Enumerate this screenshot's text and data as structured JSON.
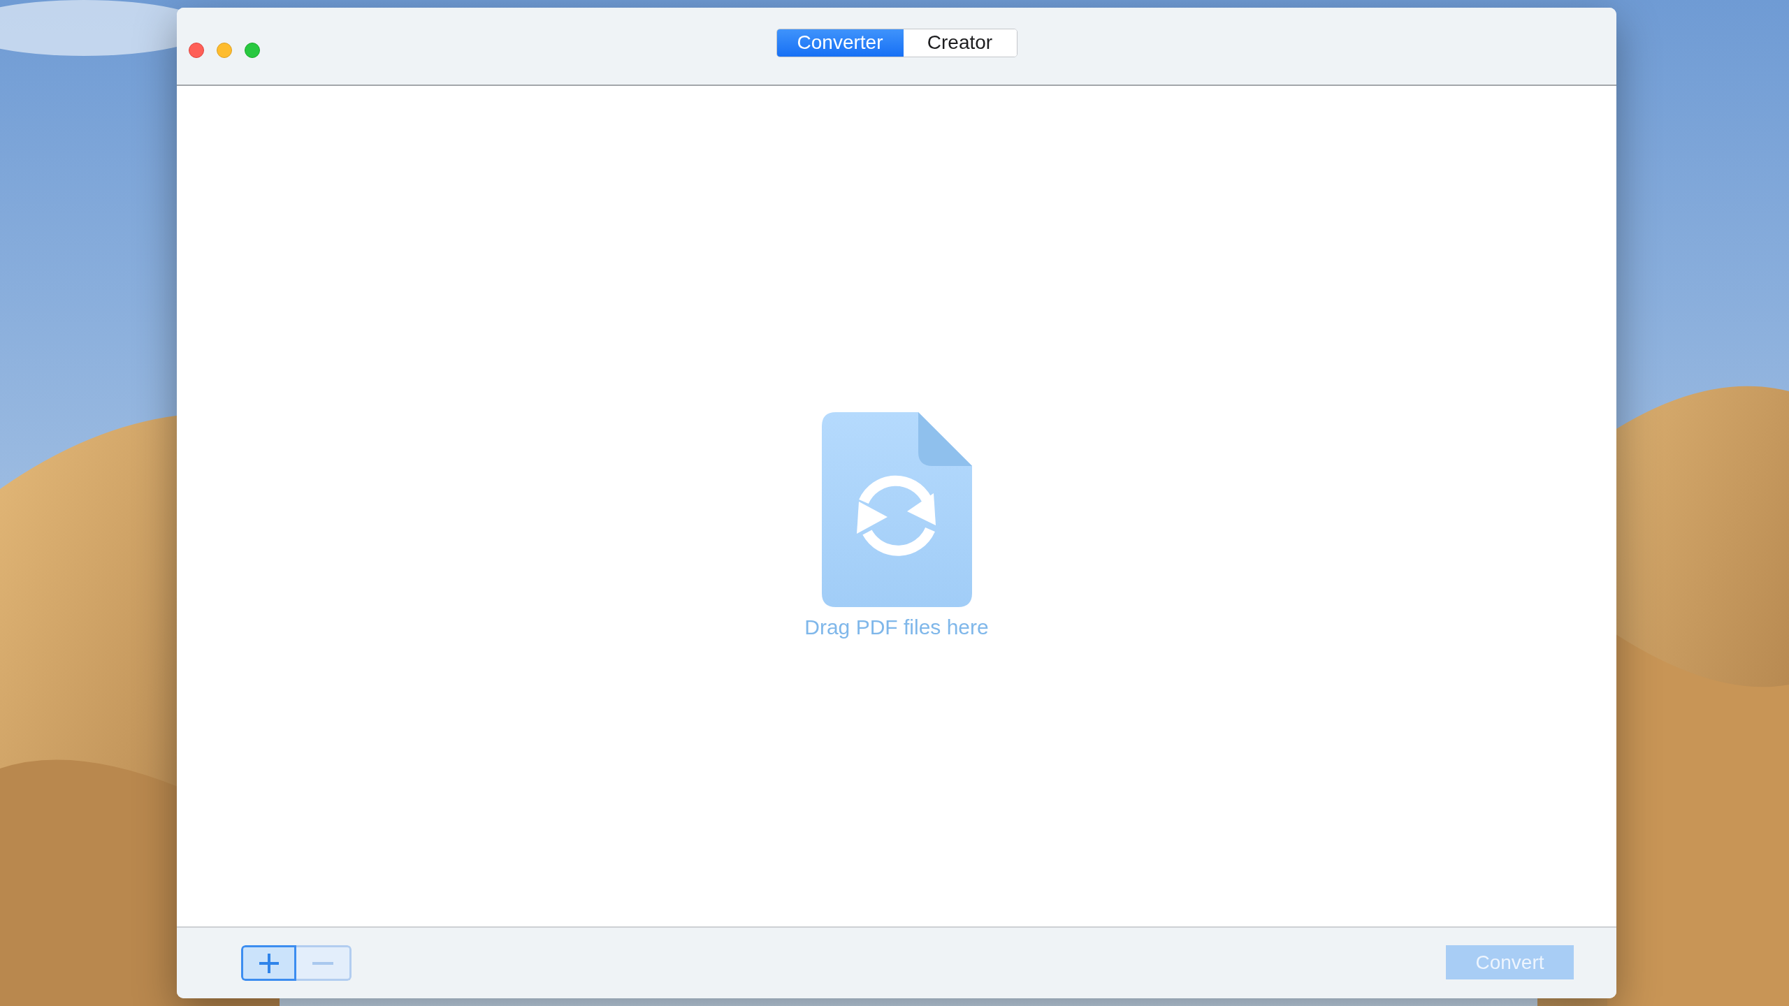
{
  "window": {
    "traffic_lights": [
      {
        "kind": "close"
      },
      {
        "kind": "minimize"
      },
      {
        "kind": "zoom"
      }
    ],
    "tabs": [
      {
        "label": "Converter",
        "selected": true
      },
      {
        "label": "Creator",
        "selected": false
      }
    ]
  },
  "drop_area": {
    "hint": "Drag PDF files here"
  },
  "bottom_bar": {
    "add_button": {
      "disabled": false
    },
    "remove_button": {
      "disabled": true
    },
    "convert_button": {
      "label": "Convert",
      "disabled": true
    }
  }
}
